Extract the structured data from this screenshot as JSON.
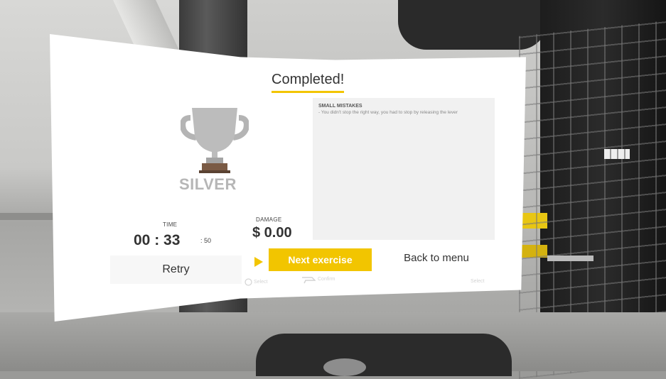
{
  "panel": {
    "title": "Completed!",
    "medal": "SILVER",
    "mistakes": {
      "heading": "SMALL MISTAKES",
      "text": "- You didn't stop the right way, you had to stop by releasing the lever"
    },
    "stats": {
      "time_label": "TIME",
      "time_value": "00 : 33",
      "time_ms": ": 50",
      "damage_label": "DAMAGE",
      "damage_value": "$ 0.00"
    },
    "buttons": {
      "retry": "Retry",
      "next": "Next exercise",
      "back": "Back to menu"
    },
    "hints": {
      "select": "Select",
      "confirm": "Confirm",
      "right": "Select"
    }
  },
  "colors": {
    "accent": "#f2c500",
    "panel": "#ffffff",
    "medal": "#b6b6b6",
    "trophy_base": "#7a5a44"
  },
  "icons": [
    "trophy-icon",
    "play-arrow-icon",
    "controller-button-icon",
    "controller-trigger-icon"
  ]
}
